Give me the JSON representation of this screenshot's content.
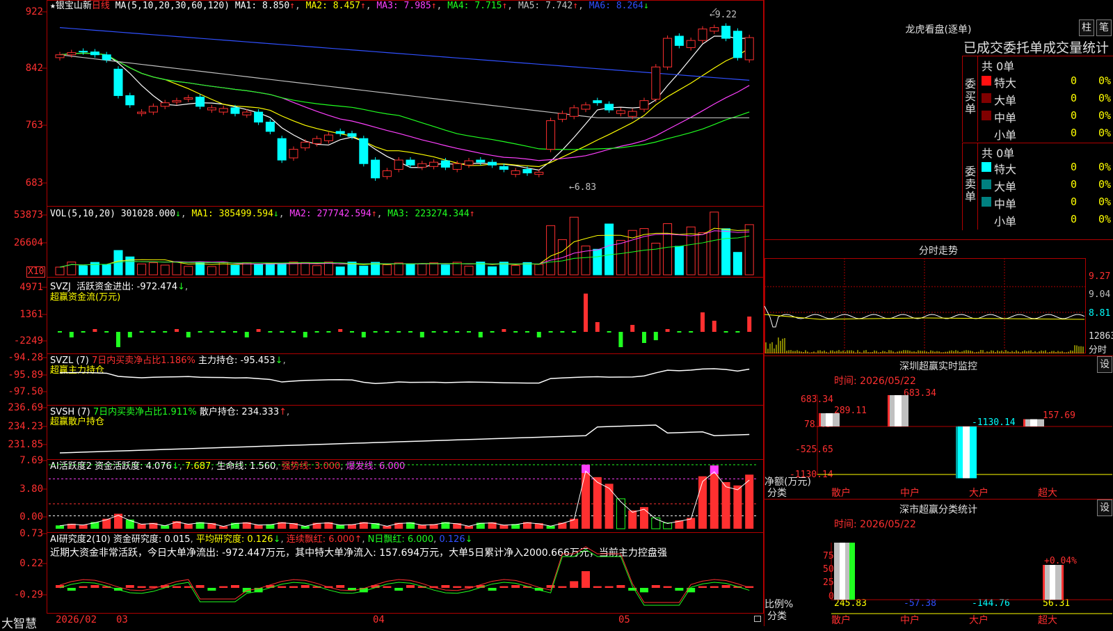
{
  "colors": {
    "up": "#ff3030",
    "down": "#00ffff",
    "border": "#b00000",
    "ma1": "#ffffff",
    "ma2": "#ffff00",
    "ma3": "#ff40ff",
    "ma4": "#20ff20",
    "ma5": "#c0c0c0",
    "ma6": "#3050ff"
  },
  "main": {
    "star": "★",
    "stock_name": "银宝山新",
    "period": "日线",
    "ma_label": "MA(5,10,20,30,60,120)",
    "ma1": "MA1: 8.850",
    "ma2": "MA2: 8.457",
    "ma3": "MA3: 7.985",
    "ma4": "MA4: 7.715",
    "ma5": "MA5: 7.742",
    "ma6": "MA6: 8.264",
    "arrow_up": "↑",
    "arrow_down": "↓",
    "yticks": [
      "922",
      "842",
      "763",
      "683"
    ],
    "high_label": "9.22",
    "low_label": "6.83"
  },
  "vol": {
    "label": "VOL(5,10,20)",
    "v": "301028.000",
    "ma1": "MA1: 385499.594",
    "ma2": "MA2: 277742.594",
    "ma3": "MA3: 223274.344",
    "yticks": [
      "53873",
      "26604"
    ],
    "unit": "X10"
  },
  "svzj": {
    "label": "SVZJ",
    "desc": "活跃资金进出: -972.474",
    "sub": "超赢资金流(万元)",
    "yticks": [
      "4971",
      "1361",
      "-2249"
    ]
  },
  "svzl": {
    "label": "SVZL (7)",
    "desc": "7日内买卖净占比1.186%",
    "hold": "主力持仓: -95.453",
    "sub": "超赢主力持仓",
    "yticks": [
      "-94.28",
      "-95.89",
      "-97.50"
    ]
  },
  "svsh": {
    "label": "SVSH (7)",
    "desc": "7日内买卖净占比1.911%",
    "hold": "散户持仓: 234.333",
    "sub": "超赢散户持仓",
    "yticks": [
      "236.69",
      "234.23",
      "231.85"
    ]
  },
  "ai1": {
    "label": "AI活跃度2",
    "v1": "资金活跃度: 4.076",
    "v2": "7.687",
    "v3": "生命线: 1.560",
    "v4": "强势线: 3.000",
    "v5": "爆发线: 6.000",
    "yticks": [
      "7.69",
      "3.80",
      "0.00"
    ]
  },
  "ai2": {
    "label": "AI研究度2(10)",
    "v1": "资金研究度: 0.015",
    "v2": "平均研究度: 0.126",
    "v3": "连续飘红: 6.000",
    "v4": "N日飘红: 6.000",
    "v5": "0.126",
    "note": "近期大资金非常活跃，今日大单净流出: -972.447万元，其中特大单净流入: 157.694万元，大单5日累计净入2000.666万元，当前主力控盘强",
    "yticks": [
      "0.73",
      "0.22",
      "-0.29"
    ]
  },
  "xaxis": {
    "brand": "大智慧",
    "labels": [
      "2026/02",
      "03",
      "04",
      "05"
    ]
  },
  "right": {
    "dragon_title": "龙虎看盘(逐单)",
    "btn_pillar": "柱",
    "btn_pen": "笔",
    "tabs_line": "已成交委托单成交量统计",
    "buy_total": "共 0单",
    "buy_side": "委买单",
    "sell_total": "共 0单",
    "sell_side": "委卖单",
    "rows": [
      {
        "name": "特大",
        "count": "0",
        "pct": "0%"
      },
      {
        "name": "大单",
        "count": "0",
        "pct": "0%"
      },
      {
        "name": "中单",
        "count": "0",
        "pct": "0%"
      },
      {
        "name": "小单",
        "count": "0",
        "pct": "0%"
      }
    ],
    "minute_title": "分时走势",
    "minute_yticks": [
      "9.27",
      "9.04",
      "8.81"
    ],
    "minute_vol": "12863",
    "minute_unit": "分时",
    "sz_title": "深圳超赢实时监控",
    "sz_btn": "设",
    "sz_time": "时间: 2026/05/22",
    "sz_yticks": [
      "683.34",
      "78.85",
      "-525.65",
      "-1130.14"
    ],
    "sz_ylabel": "净额(万元)",
    "sz_xlabel": "分类",
    "sz_values": [
      {
        "cat": "散户",
        "value": 289.11,
        "label": "289.11"
      },
      {
        "cat": "中户",
        "value": 683.34,
        "label": "683.34"
      },
      {
        "cat": "大户",
        "value": -1130.14,
        "label": "-1130.14"
      },
      {
        "cat": "超大",
        "value": 157.69,
        "label": "157.69"
      }
    ],
    "sm_title": "深市超赢分类统计",
    "sm_btn": "设",
    "sm_time": "时间: 2026/05/22",
    "sm_yticks": [
      "75",
      "50",
      "25",
      "0"
    ],
    "sm_ylabel": "比例%",
    "sm_xlabel": "分类",
    "sm_top_label": "+0.04%",
    "sm_values": [
      {
        "cat": "散户",
        "label": "245.83"
      },
      {
        "cat": "中户",
        "label": "-57.38"
      },
      {
        "cat": "大户",
        "label": "-144.76"
      },
      {
        "cat": "超大",
        "label": "56.31"
      }
    ]
  },
  "chart_data": {
    "type": "candlestick",
    "title": "银宝山新 日线",
    "yticks": [
      683,
      763,
      842,
      922
    ],
    "high": 9.22,
    "low": 6.83,
    "x_labels": [
      "2026/02",
      "03",
      "04",
      "05"
    ],
    "series": [
      {
        "name": "MA1",
        "value": 8.85
      },
      {
        "name": "MA2",
        "value": 8.457
      },
      {
        "name": "MA3",
        "value": 7.985
      },
      {
        "name": "MA4",
        "value": 7.715
      },
      {
        "name": "MA5",
        "value": 7.742
      },
      {
        "name": "MA6",
        "value": 8.264
      }
    ]
  }
}
